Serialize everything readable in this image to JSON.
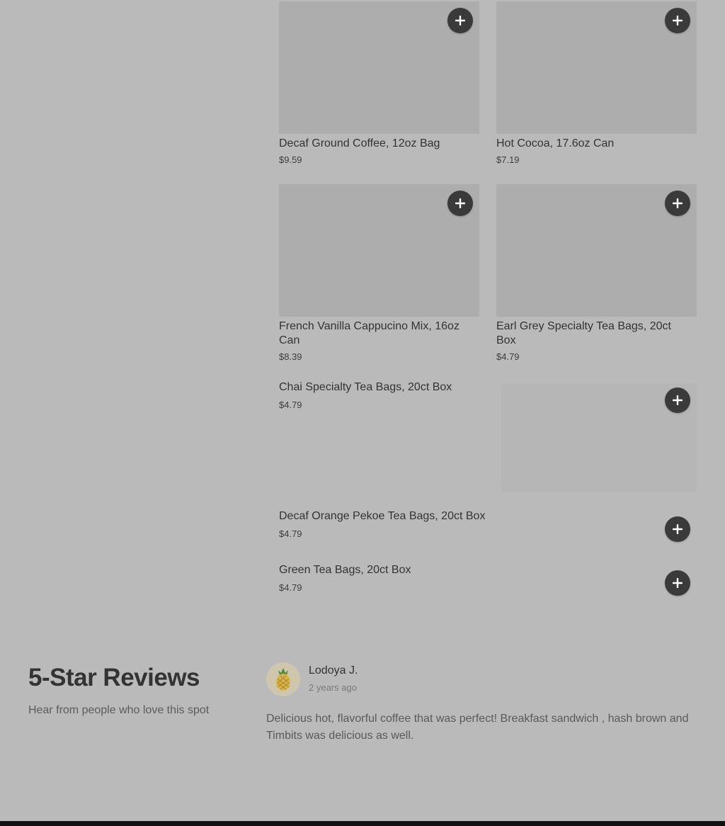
{
  "menu": {
    "items": [
      {
        "name": "Decaf Ground Coffee, 12oz Bag",
        "price": "$9.59"
      },
      {
        "name": "Hot Cocoa, 17.6oz Can",
        "price": "$7.19"
      },
      {
        "name": "French Vanilla Cappucino Mix, 16oz Can",
        "price": "$8.39"
      },
      {
        "name": "Earl Grey Specialty Tea Bags, 20ct Box",
        "price": "$4.79"
      },
      {
        "name": "Chai Specialty Tea Bags, 20ct Box",
        "price": "$4.79"
      },
      {
        "name": "Decaf Orange Pekoe Tea Bags, 20ct Box",
        "price": "$4.79"
      },
      {
        "name": "Green Tea Bags, 20ct Box",
        "price": "$4.79"
      }
    ],
    "add_icon": "plus-icon"
  },
  "reviews": {
    "title": "5-Star Reviews",
    "subtitle": "Hear from people who love this spot",
    "items": [
      {
        "reviewer": "Lodoya J.",
        "time_ago": "2 years ago",
        "avatar_icon": "pineapple-icon",
        "text": "Delicious hot, flavorful coffee that was perfect! Breakfast sandwich , hash brown and Timbits was delicious as well."
      }
    ]
  },
  "colors": {
    "overlay_background": "#bababa",
    "add_button": "#3a3a3a",
    "footer": "#111111"
  }
}
